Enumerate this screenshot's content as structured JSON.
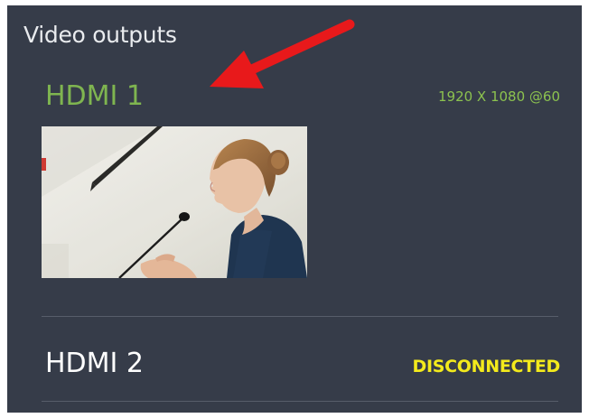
{
  "panel": {
    "title": "Video outputs"
  },
  "outputs": [
    {
      "name": "HDMI 1",
      "status": "1920 X 1080 @60",
      "state": "active",
      "status_color": "#8cc24f",
      "name_color": "#7fb550",
      "has_preview": true
    },
    {
      "name": "HDMI 2",
      "status": "DISCONNECTED",
      "state": "disconnected",
      "status_color": "#f3ea1c",
      "name_color": "#ffffff",
      "has_preview": false
    }
  ],
  "colors": {
    "panel_background": "#363c49",
    "annotation_arrow": "#e8191b"
  }
}
